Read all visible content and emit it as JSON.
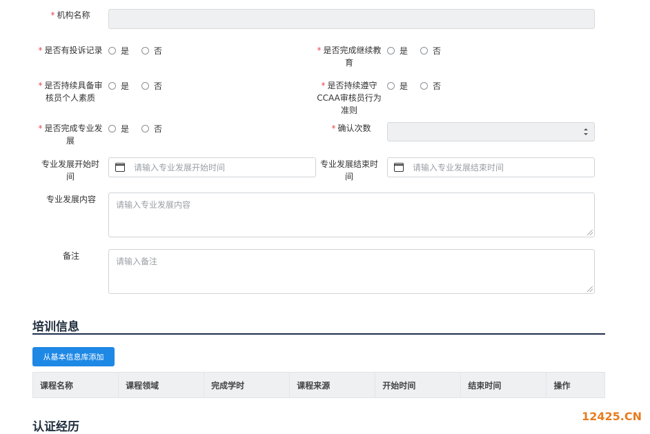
{
  "fields": {
    "org_name": {
      "label": "机构名称",
      "required": true
    },
    "complaint": {
      "label": "是否有投诉记录",
      "required": true,
      "options": [
        "是",
        "否"
      ]
    },
    "continuing_edu": {
      "label": "是否完成继续教育",
      "required": true,
      "options": [
        "是",
        "否"
      ]
    },
    "personal_quality": {
      "label": "是否持续具备审核员个人素质",
      "required": true,
      "options": [
        "是",
        "否"
      ]
    },
    "code_of_conduct": {
      "label": "是否持续遵守CCAA审核员行为准则",
      "required": true,
      "options": [
        "是",
        "否"
      ]
    },
    "prof_dev": {
      "label": "是否完成专业发展",
      "required": true,
      "options": [
        "是",
        "否"
      ]
    },
    "confirm_count": {
      "label": "确认次数",
      "required": true
    },
    "dev_start": {
      "label": "专业发展开始时间",
      "placeholder": "请输入专业发展开始时间"
    },
    "dev_end": {
      "label": "专业发展结束时间",
      "placeholder": "请输入专业发展结束时间"
    },
    "dev_content": {
      "label": "专业发展内容",
      "placeholder": "请输入专业发展内容"
    },
    "remark": {
      "label": "备注",
      "placeholder": "请输入备注"
    }
  },
  "training": {
    "title": "培训信息",
    "add_button": "从基本信息库添加",
    "columns": [
      "课程名称",
      "课程领域",
      "完成学时",
      "课程来源",
      "开始时间",
      "结束时间",
      "操作"
    ]
  },
  "certification": {
    "title": "认证经历"
  },
  "watermark": "12425.CN",
  "colors": {
    "required": "#e5484d",
    "primary": "#1e88e5",
    "section_line": "#1f2d4d",
    "watermark": "#e87c1e"
  }
}
